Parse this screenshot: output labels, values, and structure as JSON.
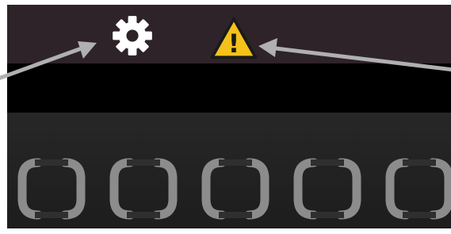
{
  "toolbar": {
    "icons": [
      "gear-icon",
      "warning-icon"
    ],
    "warning_mark": "!"
  },
  "slots": {
    "count": 5,
    "icon": "empty-bracket-slot"
  },
  "annotations": {
    "arrows": [
      "pointer-arrow-to-gear",
      "pointer-arrow-to-warning"
    ]
  },
  "colors": {
    "topbar": "#2e2328",
    "band": "#000000",
    "panel": "#1f1f1f",
    "gear": "#ffffff",
    "warning_fill": "#f4c21a",
    "slot_bracket": "#8c8c8c",
    "arrow": "#b0b0b0"
  }
}
